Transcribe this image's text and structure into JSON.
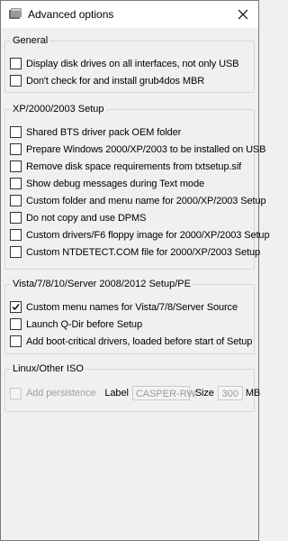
{
  "window": {
    "title": "Advanced options",
    "close_glyph": "✕"
  },
  "groups": {
    "general": {
      "legend": "General",
      "items": [
        {
          "label": "Display disk drives on all interfaces, not only USB",
          "checked": false
        },
        {
          "label": "Don't check for and install grub4dos MBR",
          "checked": false
        }
      ]
    },
    "xp": {
      "legend": "XP/2000/2003 Setup",
      "items": [
        {
          "label": "Shared BTS driver pack OEM folder",
          "checked": false
        },
        {
          "label": "Prepare Windows 2000/XP/2003 to be installed on USB",
          "checked": false
        },
        {
          "label": "Remove disk space requirements from txtsetup.sif",
          "checked": false
        },
        {
          "label": "Show debug messages during Text mode",
          "checked": false
        },
        {
          "label": "Custom folder and menu name for 2000/XP/2003 Setup",
          "checked": false
        },
        {
          "label": "Do not copy and use DPMS",
          "checked": false
        },
        {
          "label": "Custom drivers/F6 floppy image for 2000/XP/2003 Setup",
          "checked": false
        },
        {
          "label": "Custom NTDETECT.COM file for 2000/XP/2003 Setup",
          "checked": false
        }
      ]
    },
    "vista": {
      "legend": "Vista/7/8/10/Server 2008/2012 Setup/PE",
      "items": [
        {
          "label": "Custom menu names for Vista/7/8/Server Source",
          "checked": true
        },
        {
          "label": "Launch Q-Dir before Setup",
          "checked": false
        },
        {
          "label": "Add boot-critical drivers, loaded before start of Setup",
          "checked": false
        }
      ]
    },
    "linux": {
      "legend": "Linux/Other ISO",
      "persistence_label": "Add persistence",
      "label_caption": "Label",
      "label_value": "CASPER-RW",
      "size_caption": "Size",
      "size_value": "300",
      "size_unit": "MB"
    }
  },
  "colors": {
    "window_bg": "#f0f0f0",
    "title_bg": "#ffffff",
    "group_border": "#d7d7d7",
    "disabled_text": "#a0a0a0"
  },
  "icons": {
    "app": "window-icon",
    "close": "close-icon",
    "check": "check-icon"
  }
}
